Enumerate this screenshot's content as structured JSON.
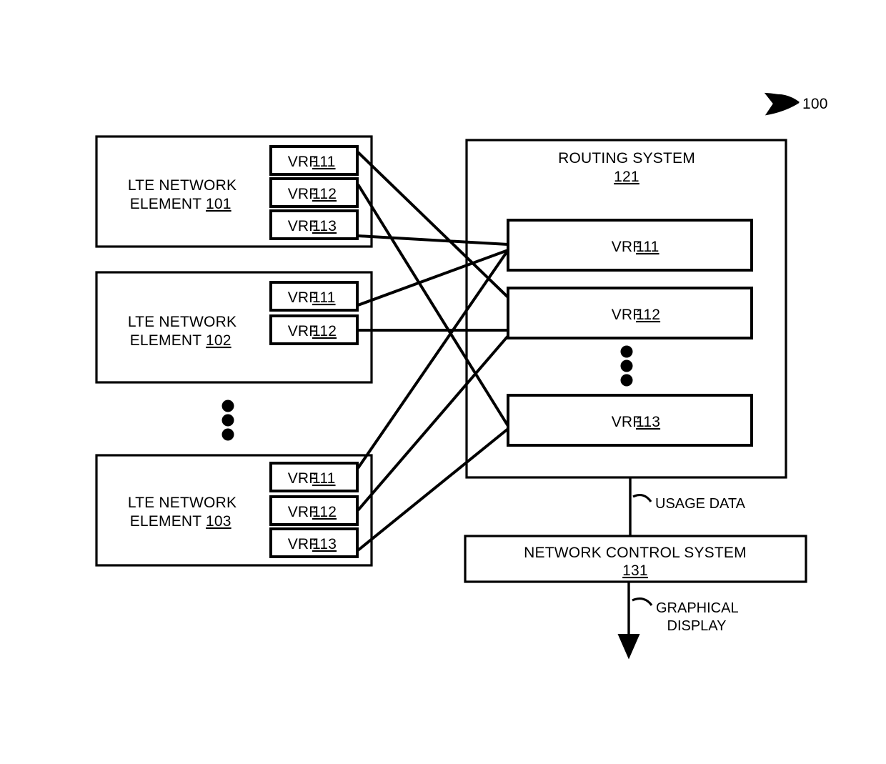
{
  "figure": {
    "label": "100",
    "label_name": "figure-reference-numeral"
  },
  "network_elements": [
    {
      "title_line1": "LTE NETWORK",
      "title_line2": "ELEMENT",
      "ref": "101",
      "vrfs": [
        {
          "label": "VRF",
          "ref": "111"
        },
        {
          "label": "VRF",
          "ref": "112"
        },
        {
          "label": "VRF",
          "ref": "113"
        }
      ]
    },
    {
      "title_line1": "LTE NETWORK",
      "title_line2": "ELEMENT",
      "ref": "102",
      "vrfs": [
        {
          "label": "VRF",
          "ref": "111"
        },
        {
          "label": "VRF",
          "ref": "112"
        }
      ]
    },
    {
      "title_line1": "LTE NETWORK",
      "title_line2": "ELEMENT",
      "ref": "103",
      "vrfs": [
        {
          "label": "VRF",
          "ref": "111"
        },
        {
          "label": "VRF",
          "ref": "112"
        },
        {
          "label": "VRF",
          "ref": "113"
        }
      ]
    }
  ],
  "routing_system": {
    "title": "ROUTING SYSTEM",
    "ref": "121",
    "vrfs": [
      {
        "label": "VRF",
        "ref": "111"
      },
      {
        "label": "VRF",
        "ref": "112"
      },
      {
        "label": "VRF",
        "ref": "113"
      }
    ]
  },
  "network_control_system": {
    "title": "NETWORK CONTROL SYSTEM",
    "ref": "131"
  },
  "flows": [
    {
      "label": "USAGE DATA"
    },
    {
      "label_line1": "GRAPHICAL",
      "label_line2": "DISPLAY"
    }
  ],
  "colors": {
    "stroke": "#000000",
    "background": "#ffffff"
  }
}
